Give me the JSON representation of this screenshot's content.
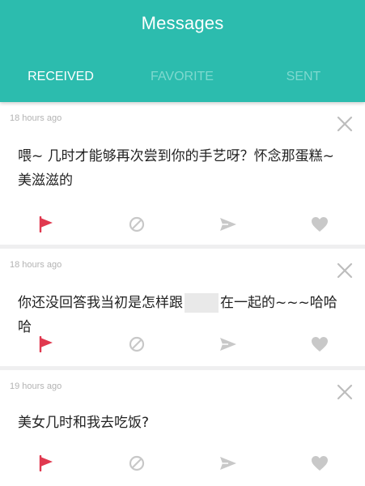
{
  "header": {
    "title": "Messages",
    "tabs": [
      {
        "label": "RECEIVED",
        "active": true
      },
      {
        "label": "FAVORITE",
        "active": false
      },
      {
        "label": "SENT",
        "active": false
      }
    ],
    "colors": {
      "accent": "#2cbcae",
      "tab_inactive": "#7fd9cf"
    }
  },
  "messages": [
    {
      "time": "18 hours ago",
      "text_line1": "喂~ 几时才能够再次尝到你的手艺呀？怀念那蛋糕~",
      "text_line2": "美滋滋的",
      "actions": [
        "flag-icon",
        "block-icon",
        "send-icon",
        "heart-icon"
      ]
    },
    {
      "time": "18 hours ago",
      "text_before": "你还没回答我当初是怎样跟",
      "text_after": "在一起的~~~哈哈哈",
      "actions": [
        "flag-icon",
        "block-icon",
        "send-icon",
        "heart-icon"
      ]
    },
    {
      "time": "19 hours ago",
      "text": "美女几时和我去吃饭?",
      "actions": [
        "flag-icon",
        "block-icon",
        "send-icon",
        "heart-icon"
      ]
    }
  ],
  "colors": {
    "flag": "#e0394f",
    "icon_gray": "#c8c8c8"
  }
}
